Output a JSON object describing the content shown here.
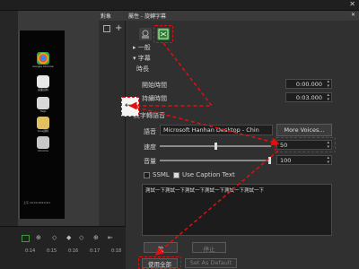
{
  "panels": {
    "mid_title": "對象",
    "props_title": "屬性 - 旋轉字幕",
    "props_close": "✕",
    "pin": "✕"
  },
  "tree": {
    "general": "一般",
    "subtitle": "字幕",
    "duration": "時長",
    "start_time_label": "開始時間",
    "start_time_value": "0:00.000",
    "length_label": "持續時間",
    "length_value": "0:03.000",
    "tts": "文字轉語音"
  },
  "voice": {
    "label": "語音",
    "selected": "Microsoft Hanhan Desktop - Chin",
    "more_button": "More Voices..."
  },
  "speed": {
    "label": "速度",
    "value": "50",
    "level": 0.5
  },
  "volume": {
    "label": "音量",
    "value": "100",
    "level": 1.0
  },
  "options": {
    "ssml_label": "SSML",
    "ssml_checked": false,
    "caption_label": "Use Caption Text",
    "caption_checked": true
  },
  "text": {
    "content": "測試一下測試一下測試一下測試一下測試一下測試一下"
  },
  "buttons": {
    "speak": "說",
    "stop": "停止",
    "apply_all": "使用全部",
    "set_default": "Set As Default"
  },
  "desktop": {
    "icons": [
      {
        "label": "Google Chrome"
      },
      {
        "label": "桌面資料"
      },
      {
        "label": "Help"
      },
      {
        "label": "Line資料"
      },
      {
        "label": "Chrome"
      }
    ],
    "bottom_text": "上午 10:24 2021/4/1"
  },
  "timeline": {
    "ticks": [
      "0:14",
      "0:15",
      "0:16",
      "0:17",
      "0:18"
    ]
  },
  "colors": {
    "annotation_red": "#e01010",
    "accent_green": "#3c9a3c"
  }
}
